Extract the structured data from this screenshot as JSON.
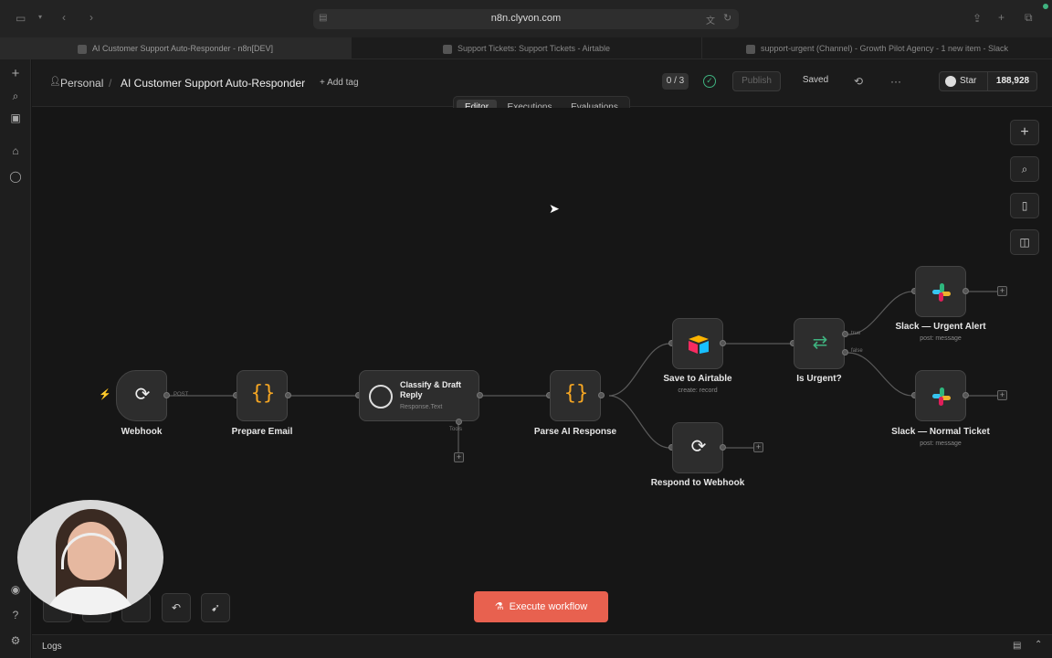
{
  "browser": {
    "url": "n8n.clyvon.com",
    "tabs": [
      {
        "label": "AI Customer Support Auto-Responder - n8n[DEV]",
        "active": true
      },
      {
        "label": "Support Tickets: Support Tickets - Airtable",
        "active": false
      },
      {
        "label": "support-urgent (Channel) - Growth Pilot Agency - 1 new item - Slack",
        "active": false
      }
    ]
  },
  "header": {
    "project": "Personal",
    "separator": "/",
    "workflow_title": "AI Customer Support Auto-Responder",
    "add_tag": "+ Add tag",
    "counter": "0 / 3",
    "publish": "Publish",
    "saved": "Saved",
    "more": "···",
    "star_label": "Star",
    "star_count": "188,928"
  },
  "view_tabs": [
    {
      "label": "Editor",
      "active": true
    },
    {
      "label": "Executions",
      "active": false
    },
    {
      "label": "Evaluations",
      "active": false
    }
  ],
  "nodes": {
    "webhook": {
      "label": "Webhook"
    },
    "prepare_email": {
      "label": "Prepare Email"
    },
    "classify": {
      "label": "Classify & Draft Reply",
      "sub": "Response.Text"
    },
    "parse": {
      "label": "Parse AI Response"
    },
    "airtable": {
      "label": "Save to Airtable",
      "sub": "create: record"
    },
    "respond": {
      "label": "Respond to Webhook"
    },
    "is_urgent": {
      "label": "Is Urgent?"
    },
    "slack_urgent": {
      "label": "Slack — Urgent Alert",
      "sub": "post: message"
    },
    "slack_normal": {
      "label": "Slack — Normal Ticket",
      "sub": "post: message"
    }
  },
  "edge_labels": {
    "post": "POST",
    "tools": "Tools",
    "true": "true",
    "false": "false"
  },
  "bottom": {
    "execute": "Execute workflow",
    "logs": "Logs"
  },
  "colors": {
    "accent": "#e8614f",
    "background": "#161616",
    "node": "#2d2d2d",
    "success": "#3fb27f"
  }
}
